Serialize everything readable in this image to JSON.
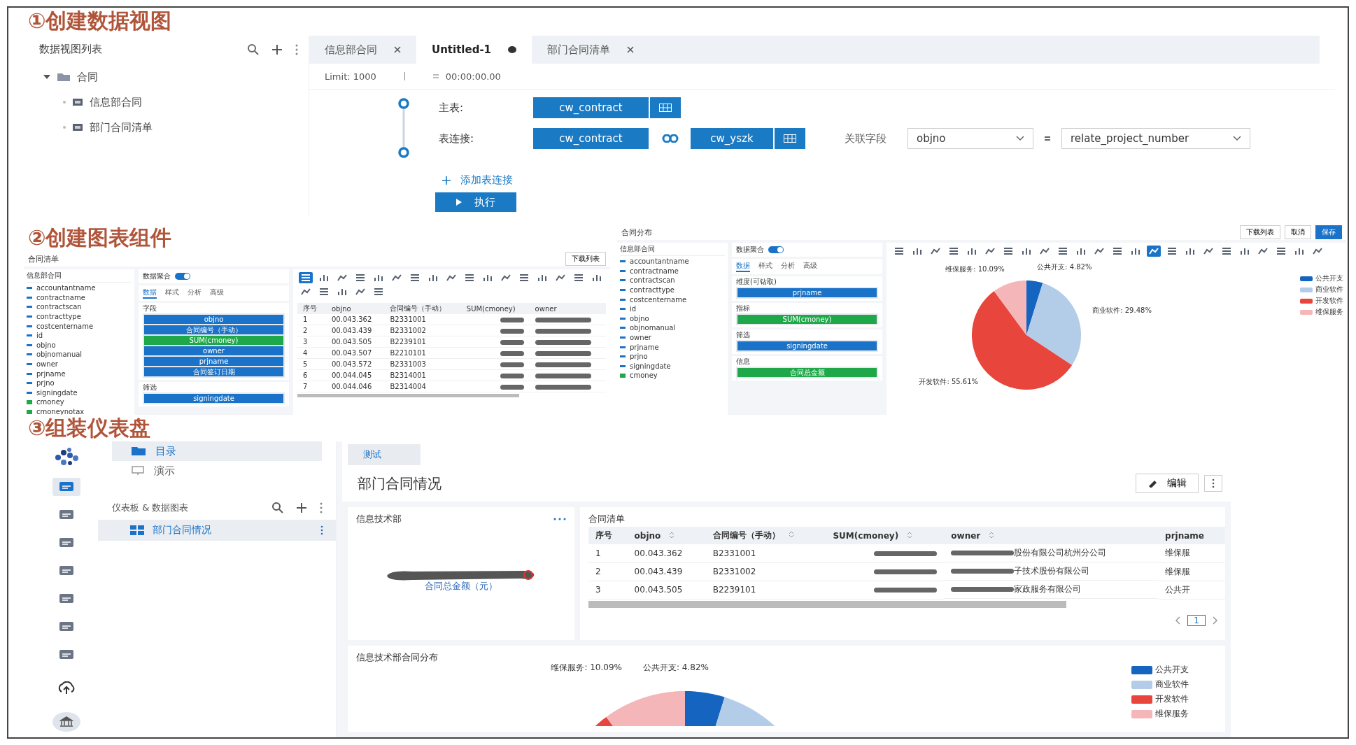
{
  "step1": {
    "title": "①创建数据视图",
    "sidebar": {
      "title": "数据视图列表",
      "tree": [
        {
          "label": "合同",
          "expanded": true,
          "children": [
            {
              "label": "信息部合同"
            },
            {
              "label": "部门合同清单"
            }
          ]
        }
      ]
    },
    "editor": {
      "tabs": [
        {
          "label": "信息部合同",
          "selected": false,
          "kind": "closable"
        },
        {
          "label": "Untitled-1",
          "selected": true,
          "kind": "unsaved"
        },
        {
          "label": "部门合同清单",
          "selected": false,
          "kind": "closable"
        }
      ],
      "limit": "Limit: 1000",
      "duration": "00:00:00.00",
      "main_label": "主表:",
      "main_table": "cw_contract",
      "join_label": "表连接:",
      "join_left": "cw_contract",
      "join_right": "cw_yszk",
      "field_label": "关联字段",
      "field_left": "objno",
      "field_right": "relate_project_number",
      "add_join": "添加表连接",
      "run": "执行"
    }
  },
  "step2": {
    "title": "②创建图表组件",
    "table_component": {
      "title": "合同清单",
      "source": "信息部合同",
      "download": "下载列表",
      "fields": [
        {
          "name": "accountantname",
          "kind": "text"
        },
        {
          "name": "contractname",
          "kind": "text"
        },
        {
          "name": "contractscan",
          "kind": "text"
        },
        {
          "name": "contracttype",
          "kind": "text"
        },
        {
          "name": "costcentername",
          "kind": "text"
        },
        {
          "name": "id",
          "kind": "text"
        },
        {
          "name": "objno",
          "kind": "text"
        },
        {
          "name": "objnomanual",
          "kind": "text"
        },
        {
          "name": "owner",
          "kind": "text"
        },
        {
          "name": "prjname",
          "kind": "text"
        },
        {
          "name": "prjno",
          "kind": "text"
        },
        {
          "name": "signingdate",
          "kind": "text"
        },
        {
          "name": "cmoney",
          "kind": "number"
        },
        {
          "name": "cmoneynotax",
          "kind": "number"
        }
      ],
      "aggregate_label": "数据聚合",
      "aggregate_on": true,
      "config_tabs": [
        {
          "label": "数据",
          "selected": true
        },
        {
          "label": "样式",
          "selected": false
        },
        {
          "label": "分析",
          "selected": false
        },
        {
          "label": "高级",
          "selected": false
        }
      ],
      "sections": [
        {
          "label": "字段",
          "chips": [
            {
              "label": "objno",
              "kind": "dimension"
            },
            {
              "label": "合同编号（手动）",
              "kind": "dimension"
            },
            {
              "label": "SUM(cmoney)",
              "kind": "metric"
            },
            {
              "label": "owner",
              "kind": "dimension"
            },
            {
              "label": "prjname",
              "kind": "dimension"
            },
            {
              "label": "合同签订日期",
              "kind": "dimension"
            }
          ]
        },
        {
          "label": "筛选",
          "chips": [
            {
              "label": "signingdate",
              "kind": "dimension"
            }
          ]
        }
      ],
      "chart_types": [
        {
          "selected": true
        },
        {
          "selected": false
        },
        {
          "selected": false
        },
        {
          "selected": false
        },
        {
          "selected": false
        },
        {
          "selected": false
        },
        {
          "selected": false
        },
        {
          "selected": false
        },
        {
          "selected": false
        },
        {
          "selected": false
        },
        {
          "selected": false
        },
        {
          "selected": false
        },
        {
          "selected": false
        },
        {
          "selected": false
        },
        {
          "selected": false
        },
        {
          "selected": false
        },
        {
          "selected": false
        },
        {
          "selected": false
        },
        {
          "selected": false
        },
        {
          "selected": false
        },
        {
          "selected": false
        },
        {
          "selected": false
        }
      ],
      "table": {
        "columns": [
          "序号",
          "objno",
          "合同编号（手动）",
          "SUM(cmoney)",
          "owner"
        ],
        "rows": [
          {
            "no": "1",
            "objno": "00.043.362",
            "contract": "B2331001"
          },
          {
            "no": "2",
            "objno": "00.043.439",
            "contract": "B2331002"
          },
          {
            "no": "3",
            "objno": "00.043.505",
            "contract": "B2239101"
          },
          {
            "no": "4",
            "objno": "00.043.507",
            "contract": "B2210101"
          },
          {
            "no": "5",
            "objno": "00.043.572",
            "contract": "B2331003"
          },
          {
            "no": "6",
            "objno": "00.044.045",
            "contract": "B2314001"
          },
          {
            "no": "7",
            "objno": "00.044.046",
            "contract": "B2314004"
          }
        ]
      }
    },
    "chart_component": {
      "title": "合同分布",
      "source": "信息部合同",
      "buttons": [
        {
          "label": "下载列表",
          "kind": "plain"
        },
        {
          "label": "取消",
          "kind": "plain"
        },
        {
          "label": "保存",
          "kind": "primary"
        }
      ],
      "fields": [
        {
          "name": "accountantname",
          "kind": "text"
        },
        {
          "name": "contractname",
          "kind": "text"
        },
        {
          "name": "contractscan",
          "kind": "text"
        },
        {
          "name": "contracttype",
          "kind": "text"
        },
        {
          "name": "costcentername",
          "kind": "text"
        },
        {
          "name": "id",
          "kind": "text"
        },
        {
          "name": "objno",
          "kind": "text"
        },
        {
          "name": "objnomanual",
          "kind": "text"
        },
        {
          "name": "owner",
          "kind": "text"
        },
        {
          "name": "prjname",
          "kind": "text"
        },
        {
          "name": "prjno",
          "kind": "text"
        },
        {
          "name": "signingdate",
          "kind": "text"
        },
        {
          "name": "cmoney",
          "kind": "number"
        }
      ],
      "aggregate_label": "数据聚合",
      "aggregate_on": true,
      "config_tabs": [
        {
          "label": "数据",
          "selected": true
        },
        {
          "label": "样式",
          "selected": false
        },
        {
          "label": "分析",
          "selected": false
        },
        {
          "label": "高级",
          "selected": false
        }
      ],
      "sections": [
        {
          "label": "维度(可钻取)",
          "chips": [
            {
              "label": "prjname",
              "kind": "dimension"
            }
          ]
        },
        {
          "label": "指标",
          "chips": [
            {
              "label": "SUM(cmoney)",
              "kind": "metric"
            }
          ]
        },
        {
          "label": "筛选",
          "chips": [
            {
              "label": "signingdate",
              "kind": "dimension"
            }
          ]
        },
        {
          "label": "信息",
          "chips": [
            {
              "label": "合同总金额",
              "kind": "metric"
            }
          ]
        }
      ],
      "chart_types": [
        {
          "selected": false
        },
        {
          "selected": false
        },
        {
          "selected": false
        },
        {
          "selected": false
        },
        {
          "selected": false
        },
        {
          "selected": false
        },
        {
          "selected": false
        },
        {
          "selected": false
        },
        {
          "selected": false
        },
        {
          "selected": false
        },
        {
          "selected": false
        },
        {
          "selected": false
        },
        {
          "selected": false
        },
        {
          "selected": false
        },
        {
          "selected": true
        },
        {
          "selected": false
        },
        {
          "selected": false
        },
        {
          "selected": false
        },
        {
          "selected": false
        },
        {
          "selected": false
        },
        {
          "selected": false
        },
        {
          "selected": false
        },
        {
          "selected": false
        },
        {
          "selected": false
        }
      ],
      "legend": [
        {
          "color": "#1565c0"
        },
        {
          "color": "#b3cde9"
        },
        {
          "color": "#e8453c"
        },
        {
          "color": "#f4b6b9"
        }
      ],
      "chart_data": {
        "type": "pie",
        "categories": [
          "公共开支",
          "商业软件",
          "开发软件",
          "维保服务"
        ],
        "values": [
          4.82,
          29.48,
          55.61,
          10.09
        ],
        "data_labels": true,
        "value_labels": [
          "公共开支: 4.82%",
          "商业软件: 29.48%",
          "开发软件: 55.61%",
          "维保服务: 10.09%"
        ]
      }
    }
  },
  "step3": {
    "title": "③组装仪表盘",
    "rail": [
      {
        "selected": true
      },
      {
        "selected": false
      },
      {
        "selected": false
      },
      {
        "selected": false
      },
      {
        "selected": false
      },
      {
        "selected": false
      },
      {
        "selected": false
      }
    ],
    "nav": [
      {
        "label": "目录",
        "selected": true
      },
      {
        "label": "演示",
        "selected": false
      }
    ],
    "tree_title": "仪表板 & 数据图表",
    "tree": [
      {
        "label": "部门合同情况",
        "selected": true
      }
    ],
    "tabs": [
      {
        "label": "测试",
        "selected": true
      }
    ],
    "dashboard_title": "部门合同情况",
    "edit": "编辑",
    "kpi": {
      "title": "信息技术部",
      "caption": "合同总金额（元）"
    },
    "table_widget": {
      "title": "合同清单",
      "columns": [
        "序号",
        "objno",
        "合同编号（手动）",
        "SUM(cmoney)",
        "owner",
        "prjname"
      ],
      "rows": [
        {
          "no": "1",
          "objno": "00.043.362",
          "contract": "B2331001",
          "owner": "股份有限公司杭州分公司",
          "prjname": "维保服"
        },
        {
          "no": "2",
          "objno": "00.043.439",
          "contract": "B2331002",
          "owner": "子技术股份有限公司",
          "prjname": "维保服"
        },
        {
          "no": "3",
          "objno": "00.043.505",
          "contract": "B2239101",
          "owner": "家政服务有限公司",
          "prjname": "公共开"
        }
      ],
      "page": "1"
    },
    "pie_widget": {
      "title": "信息技术部合同分布",
      "labels": [
        "维保服务: 10.09%",
        "公共开支: 4.82%"
      ],
      "legend": [
        {
          "label": "公共开支",
          "color": "#1565c0"
        },
        {
          "label": "商业软件",
          "color": "#b3cde9"
        },
        {
          "label": "开发软件",
          "color": "#e8453c"
        },
        {
          "label": "维保服务",
          "color": "#f4b6b9"
        }
      ]
    }
  }
}
